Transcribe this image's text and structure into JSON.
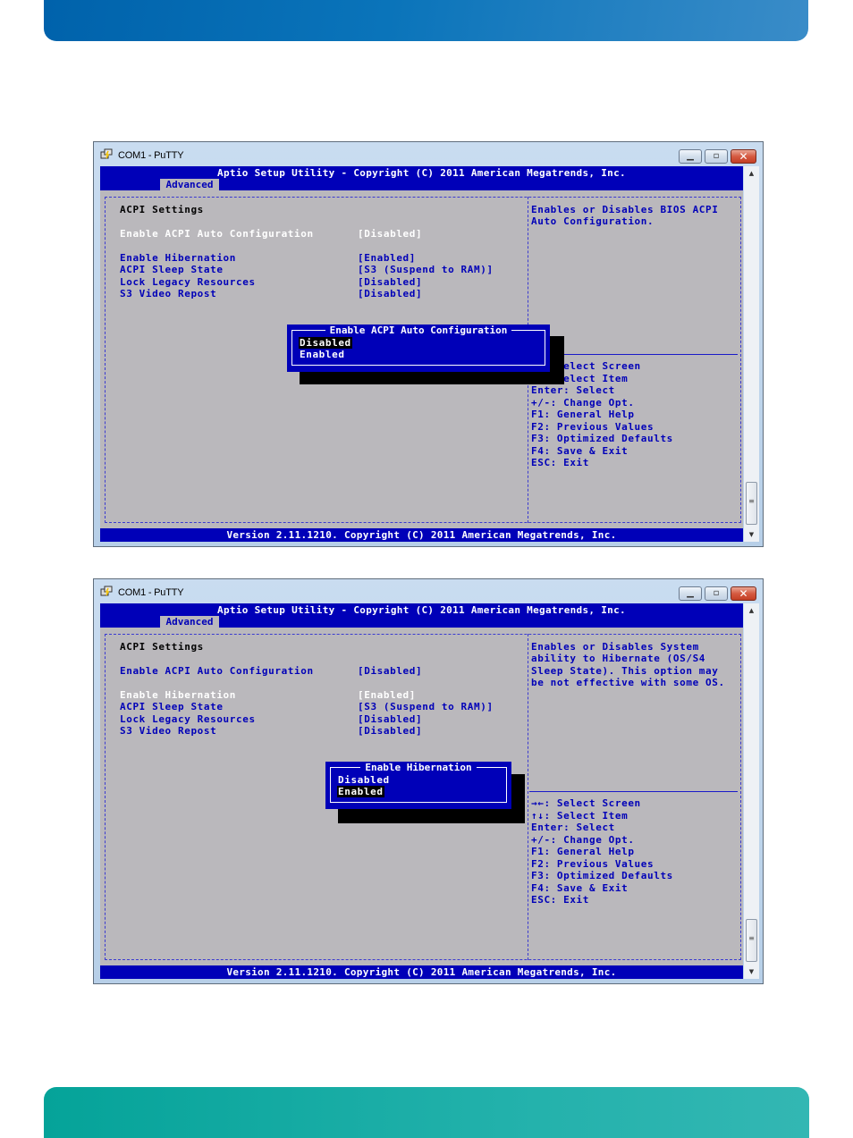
{
  "page": {
    "brand_colors": {
      "top_band": "#0062ab",
      "bottom_band": "#05a399"
    }
  },
  "windows": [
    {
      "title": "COM1 - PuTTY",
      "buttons": {
        "minimize": "▁",
        "maximize": "▫",
        "close": "✕"
      },
      "bios": {
        "header_title": "Aptio Setup Utility - Copyright (C) 2011 American Megatrends, Inc.",
        "active_tab": "Advanced",
        "section_title": "ACPI Settings",
        "settings": [
          {
            "label": "Enable ACPI Auto Configuration",
            "value": "[Disabled]",
            "highlighted": true
          },
          {
            "label": "Enable Hibernation",
            "value": "[Enabled]",
            "highlighted": false
          },
          {
            "label": "ACPI Sleep State",
            "value": "[S3 (Suspend to RAM)]",
            "highlighted": false
          },
          {
            "label": "Lock Legacy Resources",
            "value": "[Disabled]",
            "highlighted": false
          },
          {
            "label": "S3 Video Repost",
            "value": "[Disabled]",
            "highlighted": false
          }
        ],
        "help_text": [
          "Enables or Disables BIOS ACPI",
          "Auto Configuration."
        ],
        "key_help": [
          "→←: Select Screen",
          "↑↓: Select Item",
          "Enter: Select",
          "+/-: Change Opt.",
          "F1: General Help",
          "F2: Previous Values",
          "F3: Optimized Defaults",
          "F4: Save & Exit",
          "ESC: Exit"
        ],
        "popup": {
          "title": "Enable ACPI Auto Configuration",
          "options": [
            "Disabled",
            "Enabled"
          ],
          "selected": "Disabled"
        },
        "footer": "Version 2.11.1210. Copyright (C) 2011 American Megatrends, Inc."
      }
    },
    {
      "title": "COM1 - PuTTY",
      "buttons": {
        "minimize": "▁",
        "maximize": "▫",
        "close": "✕"
      },
      "bios": {
        "header_title": "Aptio Setup Utility - Copyright (C) 2011 American Megatrends, Inc.",
        "active_tab": "Advanced",
        "section_title": "ACPI Settings",
        "settings": [
          {
            "label": "Enable ACPI Auto Configuration",
            "value": "[Disabled]",
            "highlighted": false
          },
          {
            "label": "Enable Hibernation",
            "value": "[Enabled]",
            "highlighted": true
          },
          {
            "label": "ACPI Sleep State",
            "value": "[S3 (Suspend to RAM)]",
            "highlighted": false
          },
          {
            "label": "Lock Legacy Resources",
            "value": "[Disabled]",
            "highlighted": false
          },
          {
            "label": "S3 Video Repost",
            "value": "[Disabled]",
            "highlighted": false
          }
        ],
        "help_text": [
          "Enables or Disables System",
          "ability to Hibernate (OS/S4",
          "Sleep State). This option may",
          "be not effective with some OS."
        ],
        "key_help": [
          "→←: Select Screen",
          "↑↓: Select Item",
          "Enter: Select",
          "+/-: Change Opt.",
          "F1: General Help",
          "F2: Previous Values",
          "F3: Optimized Defaults",
          "F4: Save & Exit",
          "ESC: Exit"
        ],
        "popup": {
          "title": "Enable Hibernation",
          "options": [
            "Disabled",
            "Enabled"
          ],
          "selected": "Enabled"
        },
        "footer": "Version 2.11.1210. Copyright (C) 2011 American Megatrends, Inc."
      }
    }
  ]
}
